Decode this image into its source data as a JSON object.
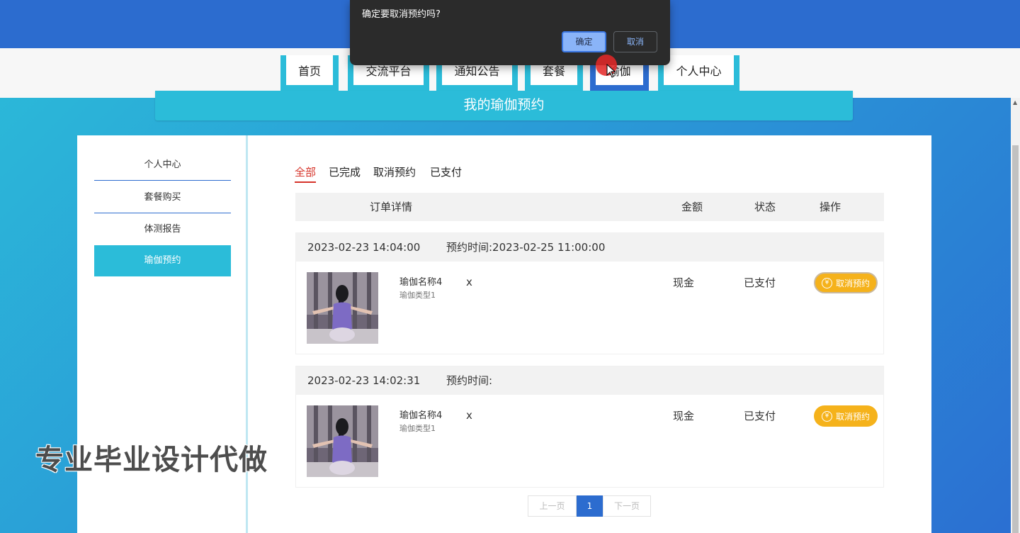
{
  "nav": {
    "items": [
      {
        "label": "首页"
      },
      {
        "label": "交流平台"
      },
      {
        "label": "通知公告"
      },
      {
        "label": "套餐"
      },
      {
        "label": "瑜伽"
      },
      {
        "label": "个人中心"
      }
    ],
    "active": "瑜伽"
  },
  "section": {
    "title": "我的瑜伽预约"
  },
  "sidebar": {
    "items": [
      {
        "label": "个人中心"
      },
      {
        "label": "套餐购买"
      },
      {
        "label": "体测报告"
      },
      {
        "label": "瑜伽预约"
      }
    ],
    "active": "瑜伽预约"
  },
  "tabs": [
    {
      "label": "全部"
    },
    {
      "label": "已完成"
    },
    {
      "label": "取消预约"
    },
    {
      "label": "已支付"
    }
  ],
  "table": {
    "headers": {
      "detail": "订单详情",
      "amount": "金额",
      "status": "状态",
      "action": "操作"
    }
  },
  "orders": [
    {
      "created": "2023-02-23 14:04:00",
      "booking": "预约时间:2023-02-25 11:00:00",
      "name": "瑜伽名称4",
      "type": "瑜伽类型1",
      "qty": "x",
      "amount": "现金",
      "status": "已支付",
      "action": "取消预约"
    },
    {
      "created": "2023-02-23 14:02:31",
      "booking": "预约时间:",
      "name": "瑜伽名称4",
      "type": "瑜伽类型1",
      "qty": "x",
      "amount": "现金",
      "status": "已支付",
      "action": "取消预约"
    }
  ],
  "pagination": {
    "prev": "上一页",
    "current": "1",
    "next": "下一页"
  },
  "dialog": {
    "message": "确定要取消预约吗?",
    "ok": "确定",
    "cancel": "取消"
  },
  "watermark": "专业毕业设计代做",
  "icons": {
    "yen": "yen-coin-icon",
    "cursor": "mouse-pointer-icon"
  },
  "colors": {
    "primary": "#2c6ccf",
    "accent": "#2bbcd9",
    "active_tab": "#d6342a",
    "action_button": "#f5b21b"
  }
}
